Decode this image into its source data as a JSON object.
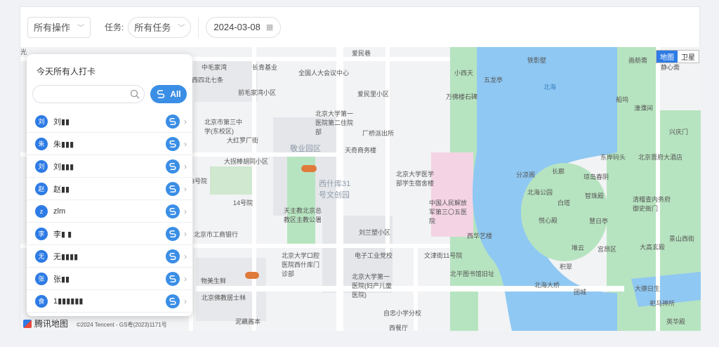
{
  "filters": {
    "operation_value": "所有操作",
    "task_label": "任务:",
    "task_value": "所有任务",
    "date_value": "2024-03-08"
  },
  "map": {
    "type_toggle": [
      "地图",
      "卫星"
    ],
    "provider": "腾讯地图",
    "copyright": "©2024 Tencent - GS粤(2023)1171号",
    "labels": [
      {
        "text": "爱民巷",
        "cls": ""
      },
      {
        "text": "铁影壁",
        "cls": ""
      },
      {
        "text": "画舫斋",
        "cls": ""
      },
      {
        "text": "中毛家湾",
        "cls": ""
      },
      {
        "text": "长青基业",
        "cls": ""
      },
      {
        "text": "全国人大会议中心",
        "cls": ""
      },
      {
        "text": "爱民里小区",
        "cls": ""
      },
      {
        "text": "小西天",
        "cls": ""
      },
      {
        "text": "五龙亭",
        "cls": ""
      },
      {
        "text": "北海",
        "cls": "blue"
      },
      {
        "text": "万佛楼石碑",
        "cls": ""
      },
      {
        "text": "前毛家湾小区",
        "cls": ""
      },
      {
        "text": "北京大学第一医院第二住院部",
        "cls": ""
      },
      {
        "text": "北京市第三中学(东校区)",
        "cls": ""
      },
      {
        "text": "厂桥派出所",
        "cls": ""
      },
      {
        "text": "大红罗厂街",
        "cls": ""
      },
      {
        "text": "敬业园区",
        "cls": "big"
      },
      {
        "text": "天奇商务楼",
        "cls": ""
      },
      {
        "text": "大拐棒胡同小区",
        "cls": ""
      },
      {
        "text": "北京大学医学部学生宿舍楼",
        "cls": ""
      },
      {
        "text": "西什库31号文创园",
        "cls": "big"
      },
      {
        "text": "中国人民解放军第三〇五医院",
        "cls": ""
      },
      {
        "text": "14号院",
        "cls": ""
      },
      {
        "text": "天主教北京总教区主教公署",
        "cls": ""
      },
      {
        "text": "北京市工商银行",
        "cls": ""
      },
      {
        "text": "刘兰塑小区",
        "cls": ""
      },
      {
        "text": "西华艺楼",
        "cls": ""
      },
      {
        "text": "北京大学口腔医院西什库门诊部",
        "cls": ""
      },
      {
        "text": "电子工业党校",
        "cls": ""
      },
      {
        "text": "文津街11号院",
        "cls": ""
      },
      {
        "text": "北京大学第一医院(妇产儿童医院)",
        "cls": ""
      },
      {
        "text": "北平图书馆旧址",
        "cls": ""
      },
      {
        "text": "物美生鲜",
        "cls": ""
      },
      {
        "text": "北京佛教居士林",
        "cls": ""
      },
      {
        "text": "自忠小学分校",
        "cls": ""
      },
      {
        "text": "泥藕酱本",
        "cls": ""
      },
      {
        "text": "分凉阁",
        "cls": ""
      },
      {
        "text": "长廊",
        "cls": ""
      },
      {
        "text": "琼岛春阴",
        "cls": ""
      },
      {
        "text": "北海公园",
        "cls": ""
      },
      {
        "text": "智珠殿",
        "cls": ""
      },
      {
        "text": "白塔",
        "cls": ""
      },
      {
        "text": "悦心殿",
        "cls": ""
      },
      {
        "text": "慧日亭",
        "cls": ""
      },
      {
        "text": "堆云",
        "cls": ""
      },
      {
        "text": "宫昂区",
        "cls": ""
      },
      {
        "text": "积翠",
        "cls": ""
      },
      {
        "text": "北海大桥",
        "cls": ""
      },
      {
        "text": "团城",
        "cls": ""
      },
      {
        "text": "东岸码头",
        "cls": ""
      },
      {
        "text": "北京晋府大酒店",
        "cls": ""
      },
      {
        "text": "清稽查内务府御史衙门",
        "cls": ""
      },
      {
        "text": "船坞",
        "cls": ""
      },
      {
        "text": "濠濮间",
        "cls": ""
      },
      {
        "text": "兴庆门",
        "cls": ""
      },
      {
        "text": "大高玄殿",
        "cls": ""
      },
      {
        "text": "景山西街",
        "cls": ""
      },
      {
        "text": "大德日生",
        "cls": ""
      },
      {
        "text": "祀马神所",
        "cls": ""
      },
      {
        "text": "英华殿",
        "cls": ""
      },
      {
        "text": "静心斋",
        "cls": ""
      },
      {
        "text": "西四北七条",
        "cls": ""
      },
      {
        "text": "3号院",
        "cls": ""
      },
      {
        "text": "西餐厅",
        "cls": ""
      },
      {
        "text": "光",
        "cls": ""
      }
    ]
  },
  "popup": {
    "title": "今天所有人打卡",
    "search_placeholder": "",
    "all_label": "All",
    "people": [
      {
        "initial": "刘",
        "name": "刘▮▮"
      },
      {
        "initial": "朱",
        "name": "朱▮▮▮"
      },
      {
        "initial": "刘",
        "name": "刘▮▮▮"
      },
      {
        "initial": "赵",
        "name": "赵▮▮"
      },
      {
        "initial": "z",
        "name": "zlm"
      },
      {
        "initial": "李",
        "name": "李▮ ▮"
      },
      {
        "initial": "无",
        "name": "无▮▮▮▮"
      },
      {
        "initial": "张",
        "name": "张▮▮"
      },
      {
        "initial": "食",
        "name": "1▮▮▮▮▮▮"
      }
    ]
  },
  "colors": {
    "accent": "#3a8ee6",
    "water": "#8fc8f2",
    "park": "#b7e4c0",
    "hospital": "#f4d4e4"
  }
}
